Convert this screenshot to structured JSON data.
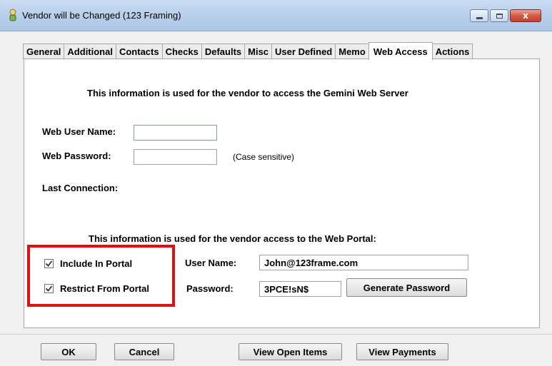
{
  "window": {
    "title": "Vendor will be Changed (123 Framing)",
    "controls": {
      "minimize": "minimize-icon",
      "maximize": "maximize-icon",
      "close": "close-icon"
    },
    "close_glyph": "x"
  },
  "tabs": [
    {
      "label": "General",
      "active": false
    },
    {
      "label": "Additional",
      "active": false
    },
    {
      "label": "Contacts",
      "active": false
    },
    {
      "label": "Checks",
      "active": false
    },
    {
      "label": "Defaults",
      "active": false
    },
    {
      "label": "Misc",
      "active": false
    },
    {
      "label": "User Defined",
      "active": false
    },
    {
      "label": "Memo",
      "active": false
    },
    {
      "label": "Web Access",
      "active": true
    },
    {
      "label": "Actions",
      "active": false
    }
  ],
  "web_server": {
    "heading": "This information is used for the vendor to access the Gemini Web Server",
    "user_name_label": "Web User Name:",
    "user_name_value": "",
    "password_label": "Web Password:",
    "password_value": "",
    "case_note": "(Case sensitive)",
    "last_connection_label": "Last Connection:"
  },
  "portal": {
    "heading": "This information is used for the vendor access to the Web Portal:",
    "include_label": "Include In Portal",
    "include_checked": true,
    "restrict_label": "Restrict From Portal",
    "restrict_checked": true,
    "user_name_label": "User Name:",
    "user_name_value": "John@123frame.com",
    "password_label": "Password:",
    "password_value": "3PCE!sN$",
    "generate_button": "Generate Password"
  },
  "footer": {
    "ok": "OK",
    "cancel": "Cancel",
    "view_open_items": "View Open Items",
    "view_payments": "View Payments"
  },
  "highlight_color": "#e01010"
}
